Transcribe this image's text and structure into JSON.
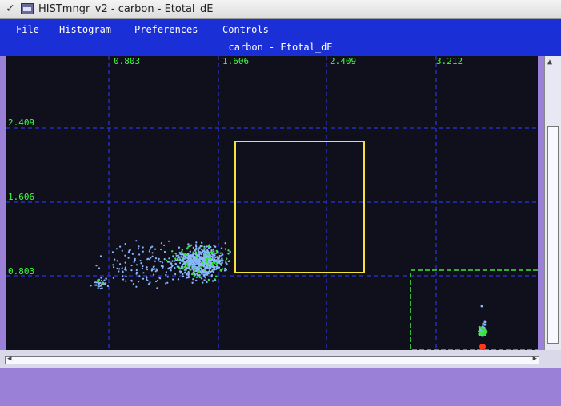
{
  "window": {
    "title": "HISTmngr_v2 - carbon - Etotal_dE"
  },
  "menu": {
    "items": [
      "File",
      "Histogram",
      "Preferences",
      "Controls"
    ]
  },
  "plot": {
    "title": "carbon - Etotal_dE",
    "colors": {
      "background": "#10101c",
      "grid": "#2b34e0",
      "tick_label": "#3cff3c",
      "gate_yellow": "#f2e23a",
      "gate_green": "#3ce43c",
      "scatter_blue": "#8ab8ff",
      "scatter_green": "#36e636",
      "hot_red": "#ff3a1a"
    },
    "x_ticks": [
      "0.803",
      "1.606",
      "2.409",
      "3.212"
    ],
    "y_ticks": [
      "2.409",
      "1.606",
      "0.803"
    ]
  }
}
